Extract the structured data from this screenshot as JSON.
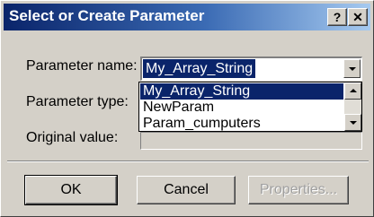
{
  "window": {
    "title": "Select or Create Parameter",
    "help_label": "?",
    "close_label": "✕"
  },
  "form": {
    "param_name_label": "Parameter name:",
    "param_name_value": "My_Array_String",
    "param_type_label": "Parameter type:",
    "original_value_label": "Original value:",
    "dropdown_items": [
      {
        "label": "My_Array_String",
        "selected": true
      },
      {
        "label": "NewParam",
        "selected": false
      },
      {
        "label": "Param_cumputers",
        "selected": false
      }
    ]
  },
  "buttons": {
    "ok_label": "OK",
    "cancel_label": "Cancel",
    "properties_label": "Properties..."
  },
  "colors": {
    "titlebar_start": "#0a246a",
    "titlebar_end": "#a6caf0",
    "selection": "#0a246a",
    "face": "#d4d0c8"
  }
}
